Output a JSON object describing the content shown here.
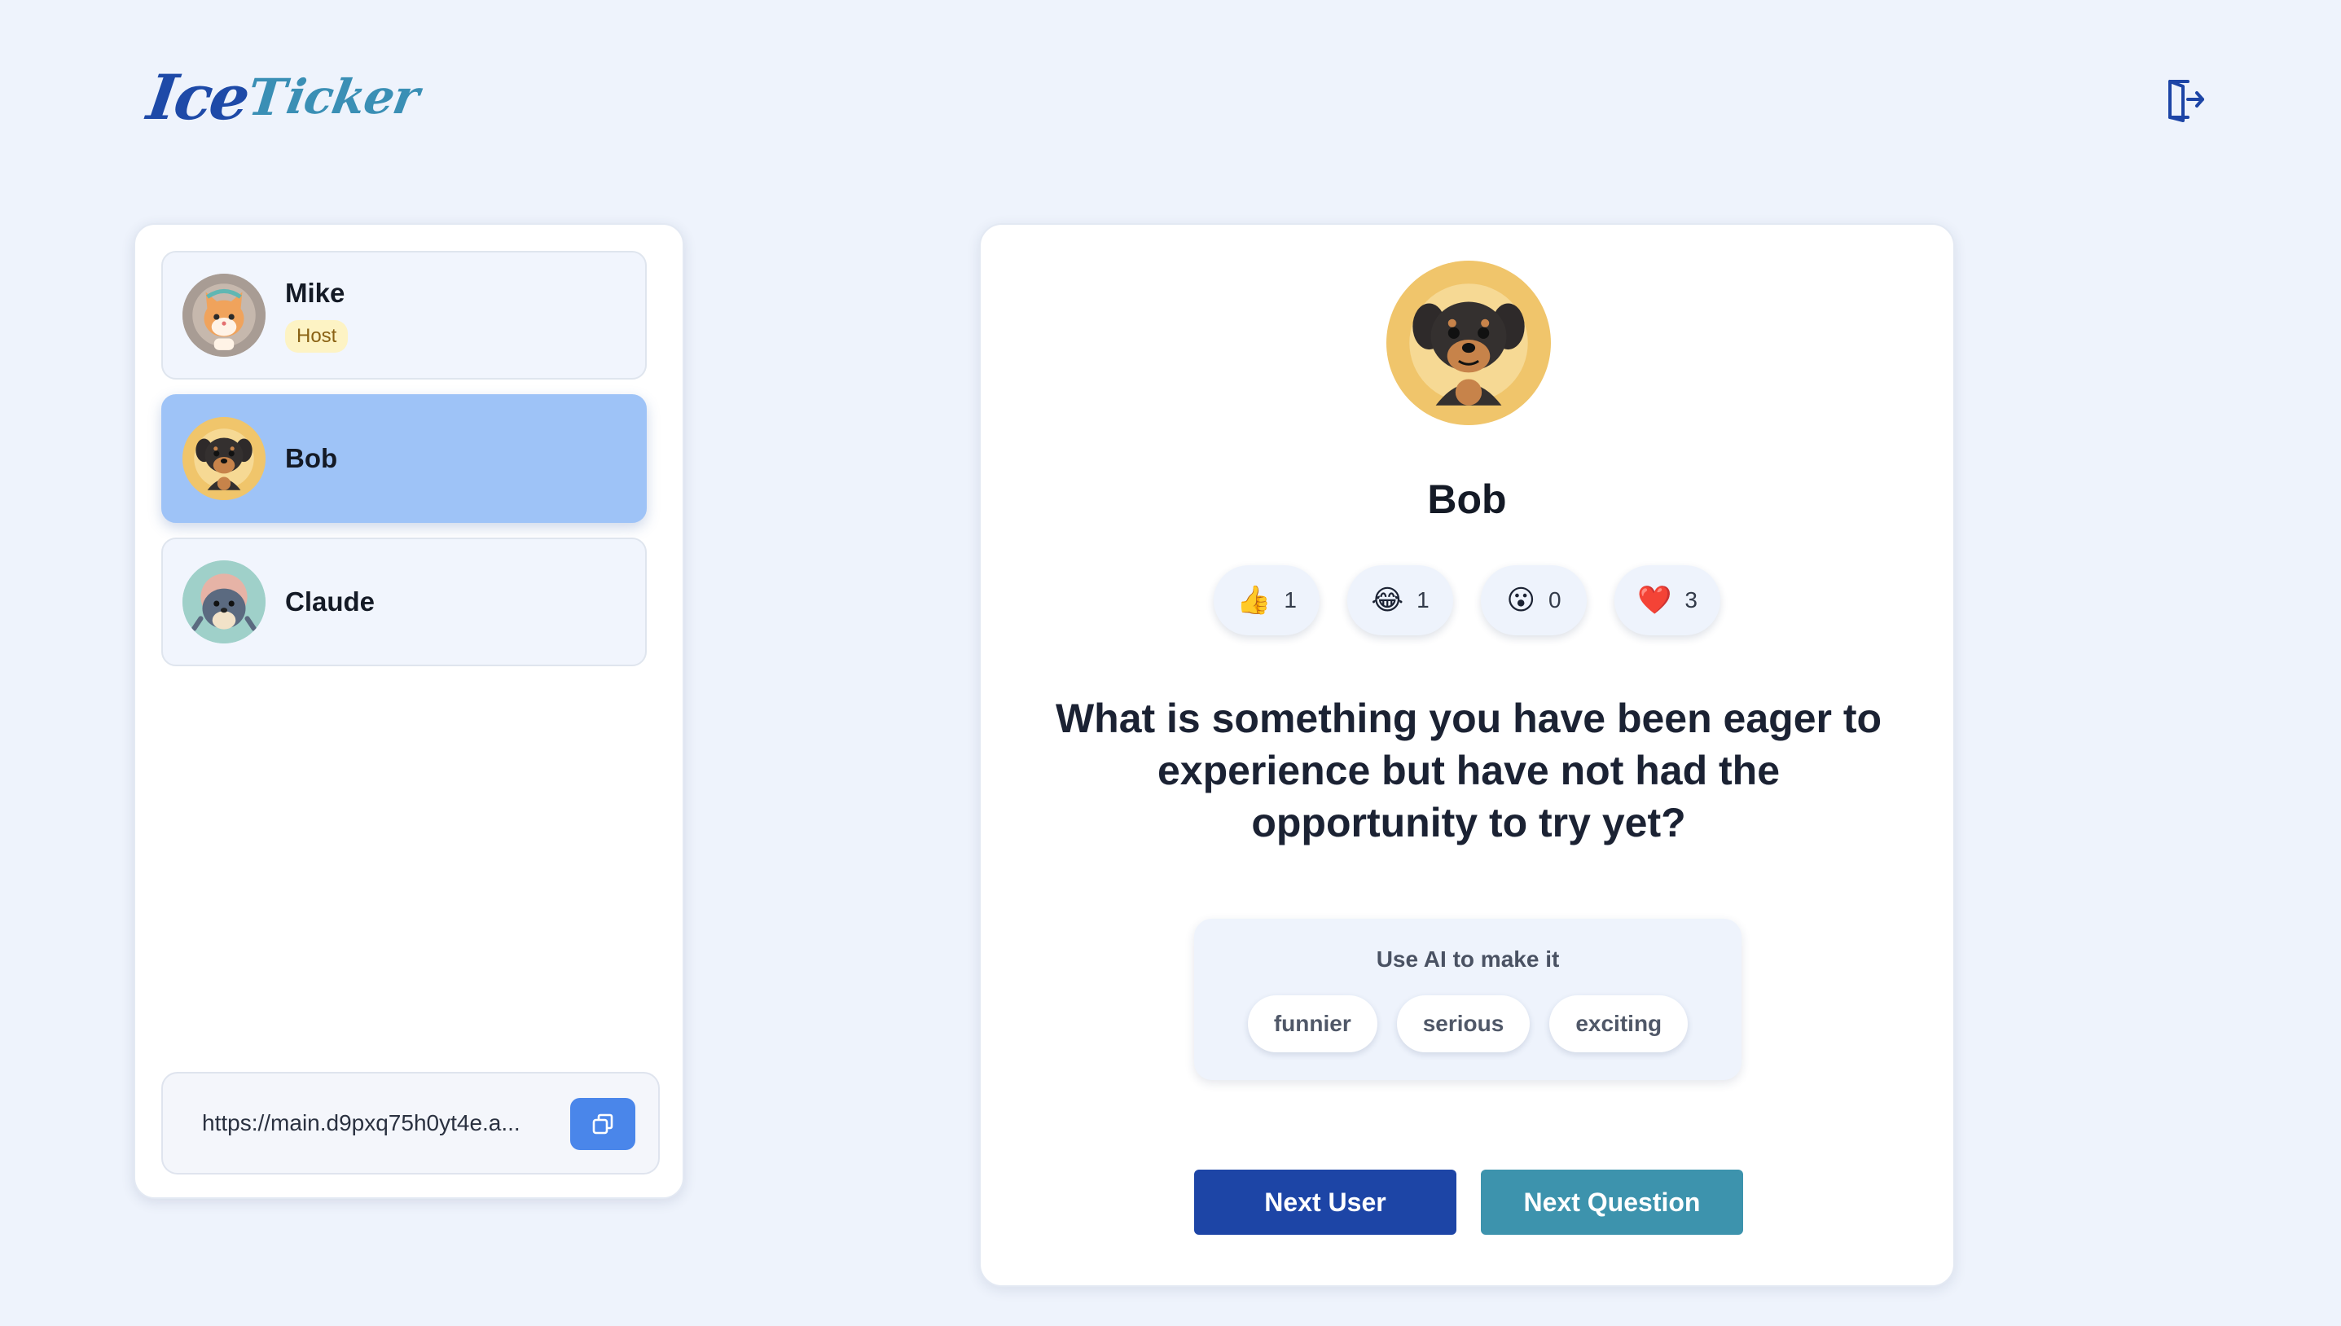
{
  "app": {
    "logo_part1": "Ice",
    "logo_part2": "T",
    "logo_part3": "icker"
  },
  "header": {
    "exit_icon": "exit-door-icon"
  },
  "users": [
    {
      "name": "Mike",
      "badge": "Host",
      "avatar": "cat-avatar",
      "active": false
    },
    {
      "name": "Bob",
      "badge": "",
      "avatar": "dog-avatar",
      "active": true
    },
    {
      "name": "Claude",
      "badge": "",
      "avatar": "seal-avatar",
      "active": false
    }
  ],
  "share": {
    "url": "https://main.d9pxq75h0yt4e.a...",
    "copy_icon": "copy-icon"
  },
  "current": {
    "name": "Bob",
    "avatar": "dog-avatar",
    "question": "What is something you have been eager to experience but have not had the opportunity to try yet?"
  },
  "reactions": [
    {
      "emoji": "👍",
      "count": "1",
      "icon": "thumbs-up-icon"
    },
    {
      "emoji": "😂",
      "count": "1",
      "icon": "laughing-icon"
    },
    {
      "emoji": "😮",
      "count": "0",
      "icon": "surprised-icon"
    },
    {
      "emoji": "❤️",
      "count": "3",
      "icon": "heart-icon"
    }
  ],
  "ai": {
    "label": "Use AI to make it",
    "options": [
      "funnier",
      "serious",
      "exciting"
    ]
  },
  "buttons": {
    "next_user": "Next User",
    "next_question": "Next Question"
  },
  "colors": {
    "primary": "#1d45a6",
    "secondary": "#3d93ad",
    "active_card": "#9ec3f7",
    "background": "#eef3fc"
  }
}
